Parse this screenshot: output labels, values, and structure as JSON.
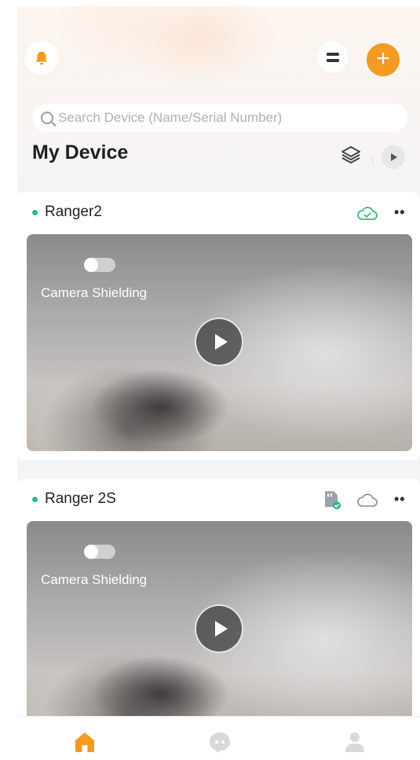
{
  "header": {
    "icons": {
      "bell": "bell-icon",
      "menu": "menu-icon",
      "add": "plus-icon"
    },
    "add_label": "+"
  },
  "search": {
    "placeholder": "Search Device (Name/Serial Number)"
  },
  "page": {
    "title": "My Device"
  },
  "devices": [
    {
      "name": "Ranger2",
      "status_color": "#2bb889",
      "camera_shielding_label": "Camera Shielding",
      "camera_shielding_on": false,
      "icons": [
        "cloud-check-icon",
        "more-icon"
      ]
    },
    {
      "name": "Ranger 2S",
      "status_color": "#2bb889",
      "camera_shielding_label": "Camera Shielding",
      "camera_shielding_on": false,
      "icons": [
        "sd-card-icon",
        "cloud-icon",
        "more-icon"
      ]
    }
  ],
  "bottom_nav": {
    "items": [
      "home-icon",
      "messages-icon",
      "profile-icon"
    ],
    "active": "home-icon"
  },
  "colors": {
    "accent": "#f39a22",
    "online": "#2bb889",
    "cloud_ok": "#3cb97a"
  }
}
